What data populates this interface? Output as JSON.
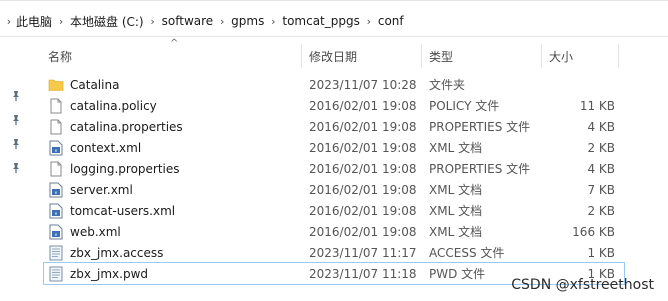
{
  "breadcrumb": [
    "此电脑",
    "本地磁盘 (C:)",
    "software",
    "gpms",
    "tomcat_ppgs",
    "conf"
  ],
  "columns": {
    "name": "名称",
    "date": "修改日期",
    "type": "类型",
    "size": "大小"
  },
  "files": [
    {
      "name": "Catalina",
      "date": "2023/11/07 10:28",
      "type": "文件夹",
      "size": "",
      "icon": "folder-icon"
    },
    {
      "name": "catalina.policy",
      "date": "2016/02/01 19:08",
      "type": "POLICY 文件",
      "size": "11 KB",
      "icon": "file-icon"
    },
    {
      "name": "catalina.properties",
      "date": "2016/02/01 19:08",
      "type": "PROPERTIES 文件",
      "size": "4 KB",
      "icon": "file-icon"
    },
    {
      "name": "context.xml",
      "date": "2016/02/01 19:08",
      "type": "XML 文档",
      "size": "2 KB",
      "icon": "xml-file-icon"
    },
    {
      "name": "logging.properties",
      "date": "2016/02/01 19:08",
      "type": "PROPERTIES 文件",
      "size": "4 KB",
      "icon": "file-icon"
    },
    {
      "name": "server.xml",
      "date": "2016/02/01 19:08",
      "type": "XML 文档",
      "size": "7 KB",
      "icon": "xml-file-icon"
    },
    {
      "name": "tomcat-users.xml",
      "date": "2016/02/01 19:08",
      "type": "XML 文档",
      "size": "2 KB",
      "icon": "xml-file-icon"
    },
    {
      "name": "web.xml",
      "date": "2016/02/01 19:08",
      "type": "XML 文档",
      "size": "166 KB",
      "icon": "xml-file-icon"
    },
    {
      "name": "zbx_jmx.access",
      "date": "2023/11/07 11:17",
      "type": "ACCESS 文件",
      "size": "1 KB",
      "icon": "text-file-icon"
    },
    {
      "name": "zbx_jmx.pwd",
      "date": "2023/11/07 11:18",
      "type": "PWD 文件",
      "size": "1 KB",
      "icon": "text-file-icon",
      "selected": true
    }
  ],
  "watermark": "CSDN @xfstreethost",
  "colors": {
    "folder": "#f7c948",
    "selection": "#99c9ef"
  }
}
